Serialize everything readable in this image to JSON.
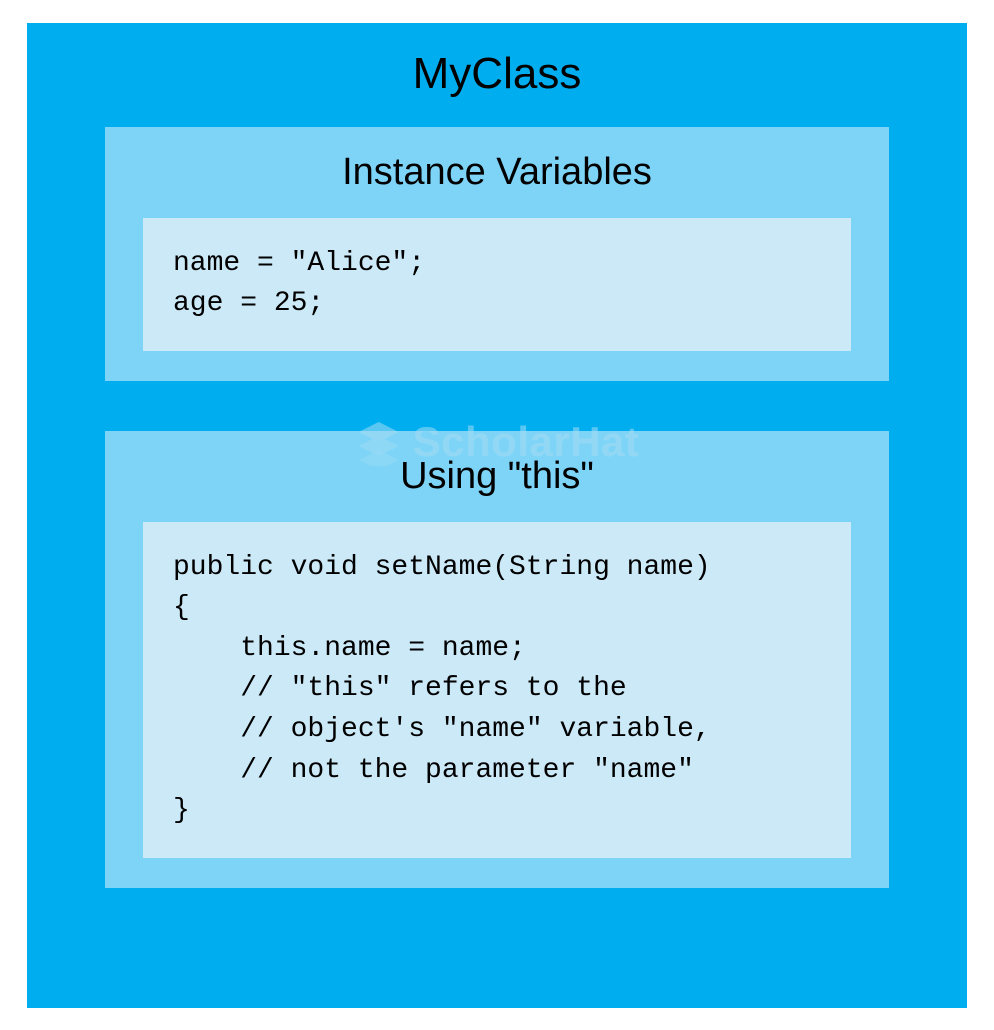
{
  "title": "MyClass",
  "panels": {
    "instance": {
      "title": "Instance Variables",
      "code": "name = \"Alice\";\nage = 25;"
    },
    "usingThis": {
      "title": "Using \"this\"",
      "code": "public void setName(String name)\n{\n    this.name = name;\n    // \"this\" refers to the\n    // object's \"name\" variable,\n    // not the parameter \"name\"\n}"
    }
  },
  "watermark": {
    "text": "ScholarHat",
    "iconName": "stack-icon"
  },
  "colors": {
    "outer": "#00aeef",
    "panel": "#7ed4f7",
    "codebox": "#cce9f8",
    "watermark": "#a3ddf5"
  }
}
